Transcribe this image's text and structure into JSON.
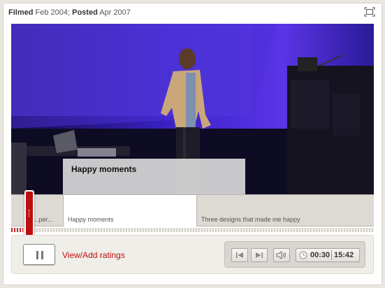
{
  "meta": {
    "filmed_label": "Filmed",
    "filmed_date": "Feb 2004;",
    "posted_label": "Posted",
    "posted_date": "Apr 2007"
  },
  "tooltip": {
    "title": "Happy moments"
  },
  "chapters": [
    {
      "label": "...per...",
      "active": false
    },
    {
      "label": "Happy moments",
      "active": true
    },
    {
      "label": "Three designs that made me happy",
      "active": false
    }
  ],
  "progress": {
    "fraction": 0.032
  },
  "controls": {
    "ratings_label": "View/Add ratings",
    "current_time": "00:30",
    "duration": "15:42"
  },
  "colors": {
    "accent": "#c00d0d",
    "stage_blue": "#2a1f86"
  },
  "icons": [
    "fullscreen-icon",
    "pause-icon",
    "previous-icon",
    "next-icon",
    "volume-icon",
    "clock-icon"
  ]
}
